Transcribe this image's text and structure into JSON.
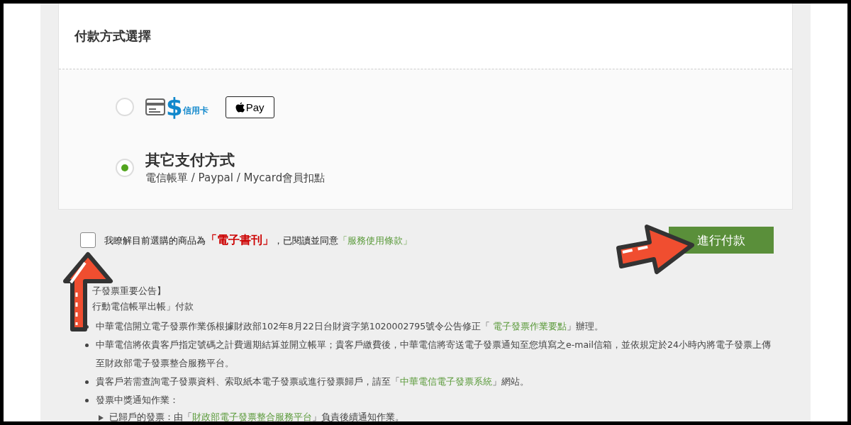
{
  "section": {
    "title": "付款方式選擇"
  },
  "payment_methods": [
    {
      "kind": "card_apple",
      "selected": false,
      "card_symbol": "$",
      "card_label": "信用卡",
      "apple_pay_label": "Pay"
    },
    {
      "kind": "other",
      "selected": true,
      "title": "其它支付方式",
      "subtitle": "電信帳單 / Paypal / Mycard會員扣點"
    }
  ],
  "agreement": {
    "checked": false,
    "text": "我瞭解目前選購的商品為**「電子書刊」**，已閱讀並同意",
    "link": "「服務使用條款」"
  },
  "pay_button": "進行付款",
  "notice": {
    "heading": "子發票重要公告】",
    "subheading": "行動電信帳單出帳」付款",
    "items": [
      {
        "before": "中華電信開立電子發票作業係根據財政部102年8月22日台財資字第1020002795號令公告修正「 ",
        "link": "電子發票作業要點",
        "after": "」辦理。"
      },
      {
        "before": "中華電信將依貴客戶指定號碼之計費週期結算並開立帳單；貴客戶繳費後，中華電信將寄送電子發票通知至您填寫之e-mail信箱，並依規定於24小時內將電子發票上傳至財政部電子發票整合服務平台。"
      },
      {
        "before": "貴客戶若需查詢電子發票資料、索取紙本電子發票或進行發票歸戶，請至「",
        "link": "中華電信電子發票系統",
        "after": "」網站。"
      },
      {
        "before": "發票中獎通知作業：",
        "children": [
          {
            "before": "已歸戶的發票：由「",
            "link": "財政部電子發票整合服務平台",
            "after": "」負責後續通知作業。"
          }
        ]
      }
    ]
  }
}
